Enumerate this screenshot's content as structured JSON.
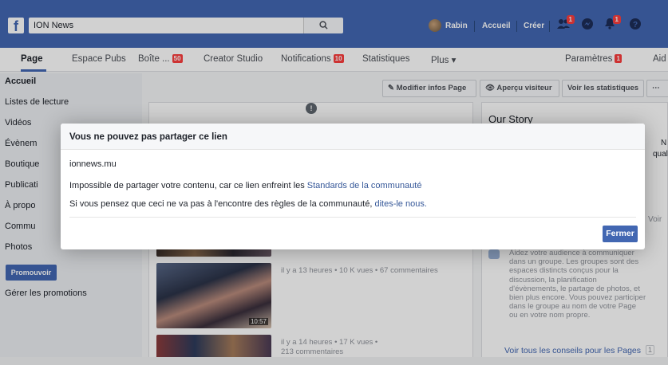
{
  "topbar": {
    "page_name": "ION News",
    "user_name": "Rabin",
    "nav_home": "Accueil",
    "nav_create": "Créer",
    "friend_requests_badge": "1",
    "notifications_badge": "1"
  },
  "tabs": {
    "page": "Page",
    "ads": "Espace Pubs",
    "inbox": "Boîte ...",
    "inbox_badge": "50",
    "creator_studio": "Creator Studio",
    "notifications": "Notifications",
    "notifications_badge": "10",
    "insights": "Statistiques",
    "more": "Plus ▾",
    "settings": "Paramètres",
    "settings_badge": "1",
    "help": "Aid"
  },
  "sidebar": {
    "items": [
      "Accueil",
      "Listes de lecture",
      "Vidéos",
      "Évènem",
      "Boutique",
      "Publicati",
      "À propo",
      "Commu",
      "Photos"
    ],
    "promote_button": "Promouvoir",
    "manage_promotions": "Gérer les promotions"
  },
  "actions": {
    "edit_page": "Modifier infos Page",
    "visitor_view": "Aperçu visiteur",
    "view_insights": "Voir les statistiques"
  },
  "right_column": {
    "our_story": "Our Story",
    "partial_n": "N",
    "partial_qual": "qual",
    "partial_voir": "Voir",
    "tips_text": "Aidez votre audience à communiquer dans un groupe. Les groupes sont des espaces distincts conçus pour la discussion, la planification d'évènements, le partage de photos, et bien plus encore. Vous pouvez participer dans le groupe au nom de votre Page ou en votre nom propre.",
    "tips_link": "Voir tous les conseils pour les Pages",
    "tips_count": "1"
  },
  "videos": [
    {
      "meta": "il y a 13 heures • 10 K vues • 67 commentaires",
      "duration": "10:57"
    },
    {
      "meta_line1": "il y a 14 heures • 17 K vues •",
      "meta_line2": "213 commentaires"
    }
  ],
  "dialog": {
    "title": "Vous ne pouvez pas partager ce lien",
    "domain": "ionnews.mu",
    "line1_text": "Impossible de partager votre contenu, car ce lien enfreint les ",
    "line1_link": "Standards de la communauté",
    "line2_text": "Si vous pensez que ceci ne va pas à l'encontre des règles de la communauté, ",
    "line2_link": "dites-le nous.",
    "close_button": "Fermer"
  },
  "colors": {
    "brand_blue": "#4267b2",
    "badge_red": "#fa3e3e",
    "link_blue": "#365899"
  }
}
